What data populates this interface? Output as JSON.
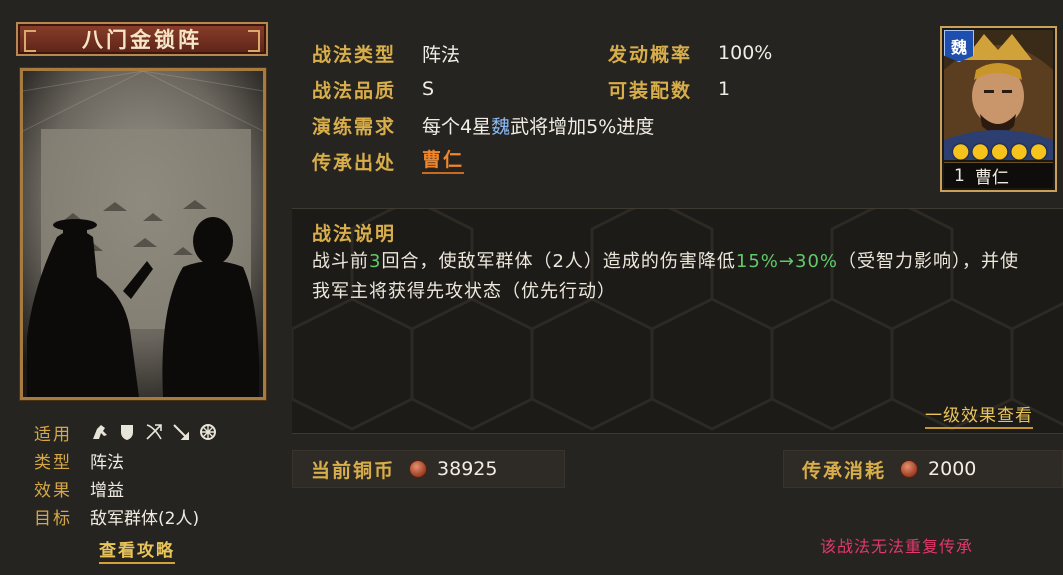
{
  "skill": {
    "name": "八门金锁阵"
  },
  "meta": {
    "applicable_label": "适用",
    "troop_icons": [
      "cavalry-icon",
      "shield-icon",
      "bow-icon",
      "spear-icon",
      "siege-icon"
    ],
    "type_label": "类型",
    "type_value": "阵法",
    "effect_label": "效果",
    "effect_value": "增益",
    "target_label": "目标",
    "target_value": "敌军群体(2人)"
  },
  "guide_link": "查看攻略",
  "info": {
    "type_label": "战法类型",
    "type_value": "阵法",
    "trigger_label": "发动概率",
    "trigger_value": "100%",
    "quality_label": "战法品质",
    "quality_value": "S",
    "equip_label": "可装配数",
    "equip_value": "1",
    "train_label": "演练需求",
    "train_pre": "每个4星",
    "train_kingdom": "魏",
    "train_post": "武将增加5%进度",
    "origin_label": "传承出处",
    "origin_value": "曹仁"
  },
  "hero": {
    "kingdom": "魏",
    "stars": 5,
    "level": "1",
    "name": "曹仁"
  },
  "description": {
    "title": "战法说明",
    "seg1": "战斗前",
    "seg2": "3",
    "seg3": "回合，使敌军群体（2人）造成的伤害降低",
    "seg4": "15%→30%",
    "seg5": "（受智力影响），并使我军主将获得先攻状态（优先行动）",
    "effects_link": "一级效果查看"
  },
  "costs": {
    "copper_label": "当前铜币",
    "copper_value": "38925",
    "inherit_label": "传承消耗",
    "inherit_value": "2000"
  },
  "warning": "该战法无法重复传承",
  "colors": {
    "gold": "#d8ae4a",
    "highlight_green": "#62c96b",
    "hero_link": "#f0852b",
    "warning": "#e0396a",
    "kingdom_blue": "#1f4fae"
  }
}
